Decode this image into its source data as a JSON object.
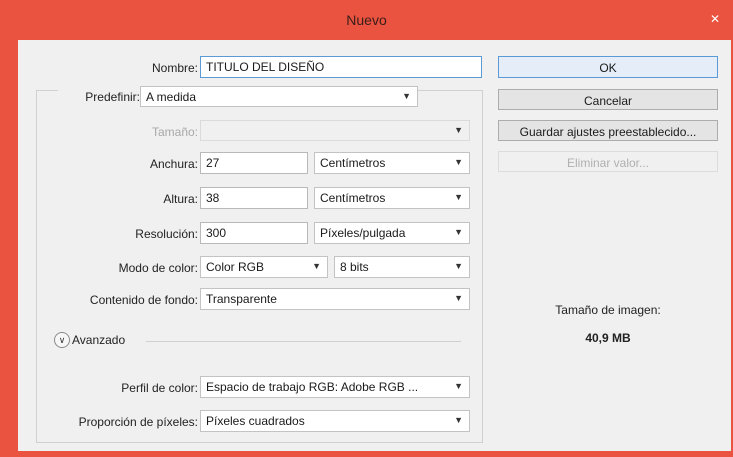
{
  "window": {
    "title": "Nuevo",
    "close_glyph": "✕"
  },
  "form": {
    "nombre": {
      "label": "Nombre:",
      "value": "TITULO DEL DISEÑO"
    },
    "predefinir": {
      "label": "Predefinir:",
      "value": "A medida"
    },
    "tamano": {
      "label": "Tamaño:",
      "value": ""
    },
    "anchura": {
      "label": "Anchura:",
      "value": "27",
      "unit": "Centímetros"
    },
    "altura": {
      "label": "Altura:",
      "value": "38",
      "unit": "Centímetros"
    },
    "resolucion": {
      "label": "Resolución:",
      "value": "300",
      "unit": "Píxeles/pulgada"
    },
    "modo_color": {
      "label": "Modo de color:",
      "value": "Color RGB",
      "bits": "8 bits"
    },
    "contenido_fondo": {
      "label": "Contenido de fondo:",
      "value": "Transparente"
    },
    "avanzado": {
      "label": "Avanzado"
    },
    "perfil_color": {
      "label": "Perfil de color:",
      "value": "Espacio de trabajo RGB: Adobe RGB ..."
    },
    "proporcion_pixeles": {
      "label": "Proporción de píxeles:",
      "value": "Píxeles cuadrados"
    }
  },
  "buttons": {
    "ok": "OK",
    "cancelar": "Cancelar",
    "guardar": "Guardar ajustes preestablecido...",
    "eliminar": "Eliminar valor..."
  },
  "info": {
    "size_label": "Tamaño de imagen:",
    "size_value": "40,9 MB"
  },
  "colors": {
    "titlebar": "#e9533f",
    "client": "#f0f0f0",
    "focus_border": "#5a9ad6"
  }
}
